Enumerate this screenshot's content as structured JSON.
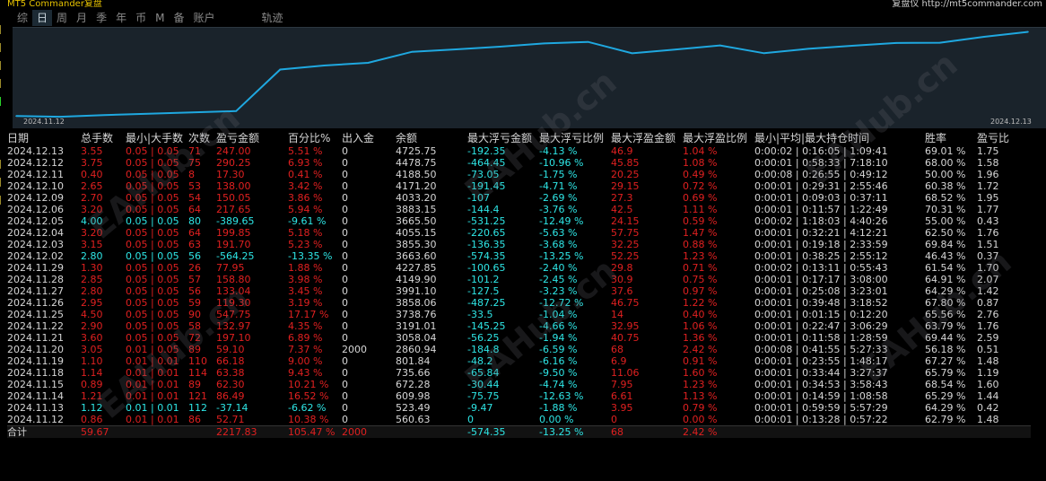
{
  "header": {
    "left_title": "MT5 Commander复盘",
    "right_title": "复盘仪 http://mt5commander.com"
  },
  "tabs": [
    "综",
    "日",
    "周",
    "月",
    "季",
    "年",
    "币",
    "M",
    "备",
    "账户",
    "轨迹"
  ],
  "active_tab": "日",
  "chart_data": {
    "type": "line",
    "x": [
      "2024.11.12",
      "2024.11.13",
      "2024.11.14",
      "2024.11.15",
      "2024.11.18",
      "2024.11.19",
      "2024.11.20",
      "2024.11.21",
      "2024.11.22",
      "2024.11.25",
      "2024.11.26",
      "2024.11.27",
      "2024.11.28",
      "2024.11.29",
      "2024.12.02",
      "2024.12.03",
      "2024.12.04",
      "2024.12.05",
      "2024.12.06",
      "2024.12.09",
      "2024.12.10",
      "2024.12.11",
      "2024.12.12",
      "2024.12.13"
    ],
    "values": [
      560.63,
      523.49,
      609.98,
      672.28,
      735.66,
      801.84,
      2860.94,
      3058.04,
      3191.01,
      3738.76,
      3858.06,
      3991.1,
      4149.9,
      4227.85,
      3663.6,
      3855.3,
      4055.15,
      3665.5,
      3883.15,
      4033.2,
      4171.2,
      4188.5,
      4478.75,
      4725.75
    ],
    "xlabel_start": "2024.11.12",
    "xlabel_end": "2024.12.13",
    "line_color": "#1fa8e0",
    "bg": "#1a232b"
  },
  "columns": [
    "日期",
    "总手数",
    "最小|大手数",
    "次数",
    "盈亏金额",
    "百分比%",
    "出入金",
    "余额",
    "最大浮亏金额",
    "最大浮亏比例",
    "最大浮盈金额",
    "最大浮盈比例",
    "最小|平均|最大持仓时间",
    "胜率",
    "盈亏比"
  ],
  "rows": [
    {
      "c": "red",
      "d": [
        "2024.12.13",
        "3.55",
        "0.05 | 0.05",
        "71",
        "247.00",
        "5.51 %",
        "0",
        "4725.75",
        "-192.35",
        "-4.13 %",
        "46.9",
        "1.04 %",
        "0:00:02 | 0:16:05 | 1:09:41",
        "69.01 %",
        "1.75"
      ]
    },
    {
      "c": "red",
      "d": [
        "2024.12.12",
        "3.75",
        "0.05 | 0.05",
        "75",
        "290.25",
        "6.93 %",
        "0",
        "4478.75",
        "-464.45",
        "-10.96 %",
        "45.85",
        "1.08 %",
        "0:00:01 | 0:58:33 | 7:18:10",
        "68.00 %",
        "1.58"
      ]
    },
    {
      "c": "red",
      "d": [
        "2024.12.11",
        "0.40",
        "0.05 | 0.05",
        "8",
        "17.30",
        "0.41 %",
        "0",
        "4188.50",
        "-73.05",
        "-1.75 %",
        "20.25",
        "0.49 %",
        "0:00:08 | 0:26:55 | 0:49:12",
        "50.00 %",
        "1.96"
      ]
    },
    {
      "c": "red",
      "d": [
        "2024.12.10",
        "2.65",
        "0.05 | 0.05",
        "53",
        "138.00",
        "3.42 %",
        "0",
        "4171.20",
        "-191.45",
        "-4.71 %",
        "29.15",
        "0.72 %",
        "0:00:01 | 0:29:31 | 2:55:46",
        "60.38 %",
        "1.72"
      ]
    },
    {
      "c": "red",
      "d": [
        "2024.12.09",
        "2.70",
        "0.05 | 0.05",
        "54",
        "150.05",
        "3.86 %",
        "0",
        "4033.20",
        "-107",
        "-2.69 %",
        "27.3",
        "0.69 %",
        "0:00:01 | 0:09:03 | 0:37:11",
        "68.52 %",
        "1.95"
      ]
    },
    {
      "c": "red",
      "d": [
        "2024.12.06",
        "3.20",
        "0.05 | 0.05",
        "64",
        "217.65",
        "5.94 %",
        "0",
        "3883.15",
        "-144.4",
        "-3.76 %",
        "42.5",
        "1.11 %",
        "0:00:01 | 0:11:57 | 1:22:49",
        "70.31 %",
        "1.77"
      ]
    },
    {
      "c": "cyan",
      "d": [
        "2024.12.05",
        "4.00",
        "0.05 | 0.05",
        "80",
        "-389.65",
        "-9.61 %",
        "0",
        "3665.50",
        "-531.25",
        "-12.49 %",
        "24.15",
        "0.59 %",
        "0:00:02 | 1:18:03 | 4:40:26",
        "55.00 %",
        "0.43"
      ]
    },
    {
      "c": "red",
      "d": [
        "2024.12.04",
        "3.20",
        "0.05 | 0.05",
        "64",
        "199.85",
        "5.18 %",
        "0",
        "4055.15",
        "-220.65",
        "-5.63 %",
        "57.75",
        "1.47 %",
        "0:00:01 | 0:32:21 | 4:12:21",
        "62.50 %",
        "1.76"
      ]
    },
    {
      "c": "red",
      "d": [
        "2024.12.03",
        "3.15",
        "0.05 | 0.05",
        "63",
        "191.70",
        "5.23 %",
        "0",
        "3855.30",
        "-136.35",
        "-3.68 %",
        "32.25",
        "0.88 %",
        "0:00:01 | 0:19:18 | 2:33:59",
        "69.84 %",
        "1.51"
      ]
    },
    {
      "c": "cyan",
      "d": [
        "2024.12.02",
        "2.80",
        "0.05 | 0.05",
        "56",
        "-564.25",
        "-13.35 %",
        "0",
        "3663.60",
        "-574.35",
        "-13.25 %",
        "52.25",
        "1.23 %",
        "0:00:01 | 0:38:25 | 2:55:12",
        "46.43 %",
        "0.37"
      ]
    },
    {
      "c": "red",
      "d": [
        "2024.11.29",
        "1.30",
        "0.05 | 0.05",
        "26",
        "77.95",
        "1.88 %",
        "0",
        "4227.85",
        "-100.65",
        "-2.40 %",
        "29.8",
        "0.71 %",
        "0:00:02 | 0:13:11 | 0:55:43",
        "61.54 %",
        "1.70"
      ]
    },
    {
      "c": "red",
      "d": [
        "2024.11.28",
        "2.85",
        "0.05 | 0.05",
        "57",
        "158.80",
        "3.98 %",
        "0",
        "4149.90",
        "-101.2",
        "-2.45 %",
        "30.9",
        "0.75 %",
        "0:00:01 | 0:17:17 | 3:08:00",
        "64.91 %",
        "2.07"
      ]
    },
    {
      "c": "red",
      "d": [
        "2024.11.27",
        "2.80",
        "0.05 | 0.05",
        "56",
        "133.04",
        "3.45 %",
        "0",
        "3991.10",
        "-127.5",
        "-3.23 %",
        "37.6",
        "0.97 %",
        "0:00:01 | 0:25:08 | 3:23:01",
        "64.29 %",
        "1.42"
      ]
    },
    {
      "c": "red",
      "d": [
        "2024.11.26",
        "2.95",
        "0.05 | 0.05",
        "59",
        "119.30",
        "3.19 %",
        "0",
        "3858.06",
        "-487.25",
        "-12.72 %",
        "46.75",
        "1.22 %",
        "0:00:01 | 0:39:48 | 3:18:52",
        "67.80 %",
        "0.87"
      ]
    },
    {
      "c": "red",
      "d": [
        "2024.11.25",
        "4.50",
        "0.05 | 0.05",
        "90",
        "547.75",
        "17.17 %",
        "0",
        "3738.76",
        "-33.5",
        "-1.04 %",
        "14",
        "0.40 %",
        "0:00:01 | 0:01:15 | 0:12:20",
        "65.56 %",
        "2.76"
      ]
    },
    {
      "c": "red",
      "d": [
        "2024.11.22",
        "2.90",
        "0.05 | 0.05",
        "58",
        "132.97",
        "4.35 %",
        "0",
        "3191.01",
        "-145.25",
        "-4.66 %",
        "32.95",
        "1.06 %",
        "0:00:01 | 0:22:47 | 3:06:29",
        "63.79 %",
        "1.76"
      ]
    },
    {
      "c": "red",
      "d": [
        "2024.11.21",
        "3.60",
        "0.05 | 0.05",
        "72",
        "197.10",
        "6.89 %",
        "0",
        "3058.04",
        "-56.25",
        "-1.94 %",
        "40.75",
        "1.36 %",
        "0:00:01 | 0:11:58 | 1:28:59",
        "69.44 %",
        "2.59"
      ]
    },
    {
      "c": "red",
      "d": [
        "2024.11.20",
        "3.05",
        "0.01 | 0.05",
        "89",
        "59.10",
        "7.37 %",
        "2000",
        "2860.94",
        "-184.8",
        "-6.59 %",
        "68",
        "2.42 %",
        "0:00:08 | 0:41:55 | 5:27:33",
        "56.18 %",
        "0.51"
      ]
    },
    {
      "c": "red",
      "d": [
        "2024.11.19",
        "1.10",
        "0.01 | 0.01",
        "110",
        "66.18",
        "9.00 %",
        "0",
        "801.84",
        "-48.2",
        "-6.16 %",
        "6.9",
        "0.91 %",
        "0:00:01 | 0:23:55 | 1:48:17",
        "67.27 %",
        "1.48"
      ]
    },
    {
      "c": "red",
      "d": [
        "2024.11.18",
        "1.14",
        "0.01 | 0.01",
        "114",
        "63.38",
        "9.43 %",
        "0",
        "735.66",
        "-65.84",
        "-9.50 %",
        "11.06",
        "1.60 %",
        "0:00:01 | 0:33:44 | 3:27:37",
        "65.79 %",
        "1.19"
      ]
    },
    {
      "c": "red",
      "d": [
        "2024.11.15",
        "0.89",
        "0.01 | 0.01",
        "89",
        "62.30",
        "10.21 %",
        "0",
        "672.28",
        "-30.44",
        "-4.74 %",
        "7.95",
        "1.23 %",
        "0:00:01 | 0:34:53 | 3:58:43",
        "68.54 %",
        "1.60"
      ]
    },
    {
      "c": "red",
      "d": [
        "2024.11.14",
        "1.21",
        "0.01 | 0.01",
        "121",
        "86.49",
        "16.52 %",
        "0",
        "609.98",
        "-75.75",
        "-12.63 %",
        "6.61",
        "1.13 %",
        "0:00:01 | 0:14:59 | 1:08:58",
        "65.29 %",
        "1.44"
      ]
    },
    {
      "c": "cyan",
      "d": [
        "2024.11.13",
        "1.12",
        "0.01 | 0.01",
        "112",
        "-37.14",
        "-6.62 %",
        "0",
        "523.49",
        "-9.47",
        "-1.88 %",
        "3.95",
        "0.79 %",
        "0:00:01 | 0:59:59 | 5:57:29",
        "64.29 %",
        "0.42"
      ]
    },
    {
      "c": "red",
      "d": [
        "2024.11.12",
        "0.86",
        "0.01 | 0.01",
        "86",
        "52.71",
        "10.38 %",
        "0",
        "560.63",
        "0",
        "0.00 %",
        "0",
        "0.00 %",
        "0:00:01 | 0:13:28 | 0:57:22",
        "62.79 %",
        "1.48"
      ]
    }
  ],
  "total": {
    "label": "合计",
    "d": [
      "59.67",
      "",
      "",
      "2217.83",
      "105.47 %",
      "2000",
      "",
      "-574.35",
      "-13.25 %",
      "68",
      "2.42 %",
      "",
      "",
      ""
    ]
  },
  "watermark": "EAHub.cn"
}
